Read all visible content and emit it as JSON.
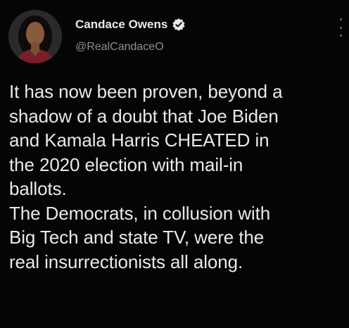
{
  "tweet": {
    "display_name": "Candace Owens",
    "handle": "@RealCandaceO",
    "verified": true,
    "body_lines": [
      "It has now been proven, beyond a",
      "shadow of a doubt that Joe Biden",
      "and Kamala Harris CHEATED in",
      "the 2020 election with mail-in",
      "ballots.",
      "The Democrats, in collusion with",
      "Big Tech and state TV, were the",
      "real insurrectionists all along."
    ]
  },
  "icons": {
    "verified": "verified-badge-icon",
    "more": "more-options-icon"
  },
  "colors": {
    "background": "#000000",
    "text": "#e7e9ea",
    "secondary_text": "#8b9096"
  }
}
